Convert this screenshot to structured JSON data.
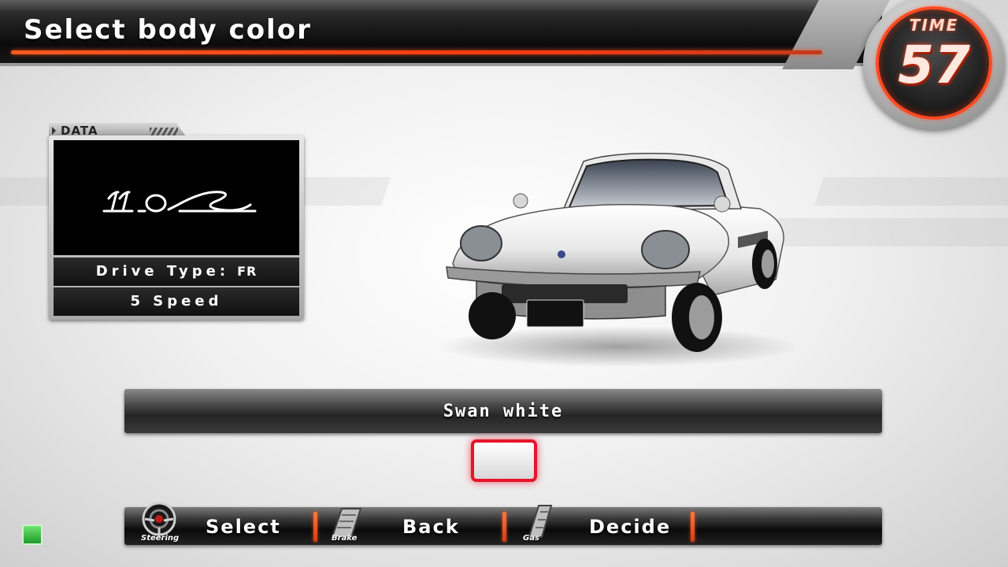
{
  "header": {
    "title": "Select body color"
  },
  "timer": {
    "label": "TIME",
    "value": "57"
  },
  "data_panel": {
    "tab_label": "DATA",
    "car_logo_text": "110S",
    "drive_type_label": "Drive Type:",
    "drive_type_value": "FR",
    "transmission": "5 Speed"
  },
  "color": {
    "name": "Swan white",
    "swatch_color": "#ffffff",
    "selected_border": "#e8142a"
  },
  "controls": [
    {
      "icon": "steering-wheel-icon",
      "icon_caption": "Steering",
      "label": "Select"
    },
    {
      "icon": "brake-pedal-icon",
      "icon_caption": "Brake",
      "label": "Back"
    },
    {
      "icon": "gas-pedal-icon",
      "icon_caption": "Gas",
      "label": "Decide"
    }
  ],
  "colors": {
    "accent": "#ff4a1a",
    "bar_dark": "#111111"
  }
}
